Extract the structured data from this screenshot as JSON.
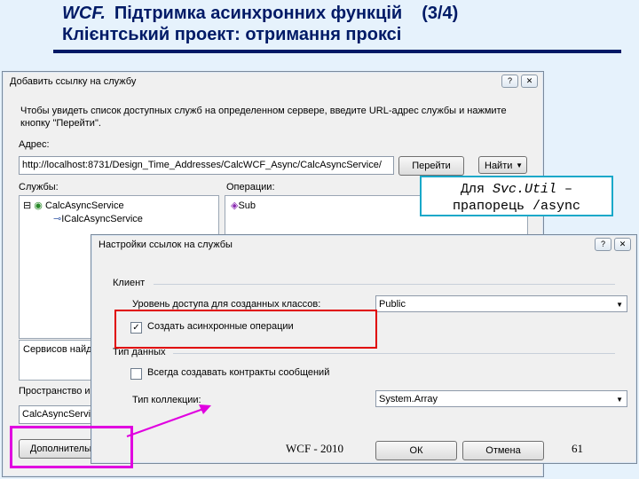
{
  "slide": {
    "title_wcf": "WCF.",
    "title_main": "Підтримка асинхронних функцій",
    "title_counter": "(3/4)",
    "subtitle": "Клієнтський проект: отримання проксі"
  },
  "dialog1": {
    "title": "Добавить ссылку на службу",
    "instruction_line1": "Чтобы увидеть список доступных служб на определенном сервере, введите URL-адрес службы и нажмите",
    "instruction_line2": "кнопку \"Перейти\".",
    "address_label": "Адрес:",
    "address_value": "http://localhost:8731/Design_Time_Addresses/CalcWCF_Async/CalcAsyncService/",
    "go_button": "Перейти",
    "find_button": "Найти",
    "services_label": "Службы:",
    "services": [
      "CalcAsyncService",
      "ICalcAsyncService"
    ],
    "operations_label": "Операции:",
    "operations": [
      "Sub"
    ],
    "status_text": "Сервисов найде",
    "namespace_label": "Пространство и",
    "namespace_value": "CalcAsyncServiceReference",
    "advanced_button": "Дополнительно...",
    "close_glyph": "✕"
  },
  "dialog2": {
    "title": "Настройки ссылок на службы",
    "client_group": "Клиент",
    "access_level_label": "Уровень доступа для созданных классов:",
    "access_level_value": "Public",
    "async_checkbox_label": "Создать асинхронные операции",
    "async_checked": true,
    "data_type_group": "Тип данных",
    "always_generate_label": "Всегда создавать контракты сообщений",
    "always_generate_checked": false,
    "collection_type_label": "Тип коллекции:",
    "collection_type_value": "System.Array",
    "ok_button": "ОК",
    "cancel_button": "Отмена",
    "close_glyph": "✕"
  },
  "callout": {
    "line1_prefix": "Для",
    "line1_cmd": "Svc.Util",
    "line1_suffix": "–",
    "line2": "прапорець /async"
  },
  "footer": {
    "center": "WCF - 2010",
    "page": "61"
  },
  "colors": {
    "slide_bg": "#e6f2fc",
    "title": "#001a66",
    "callout_border": "#19a8c9",
    "red_highlight": "#e00000",
    "magenta_highlight": "#e000e0"
  }
}
